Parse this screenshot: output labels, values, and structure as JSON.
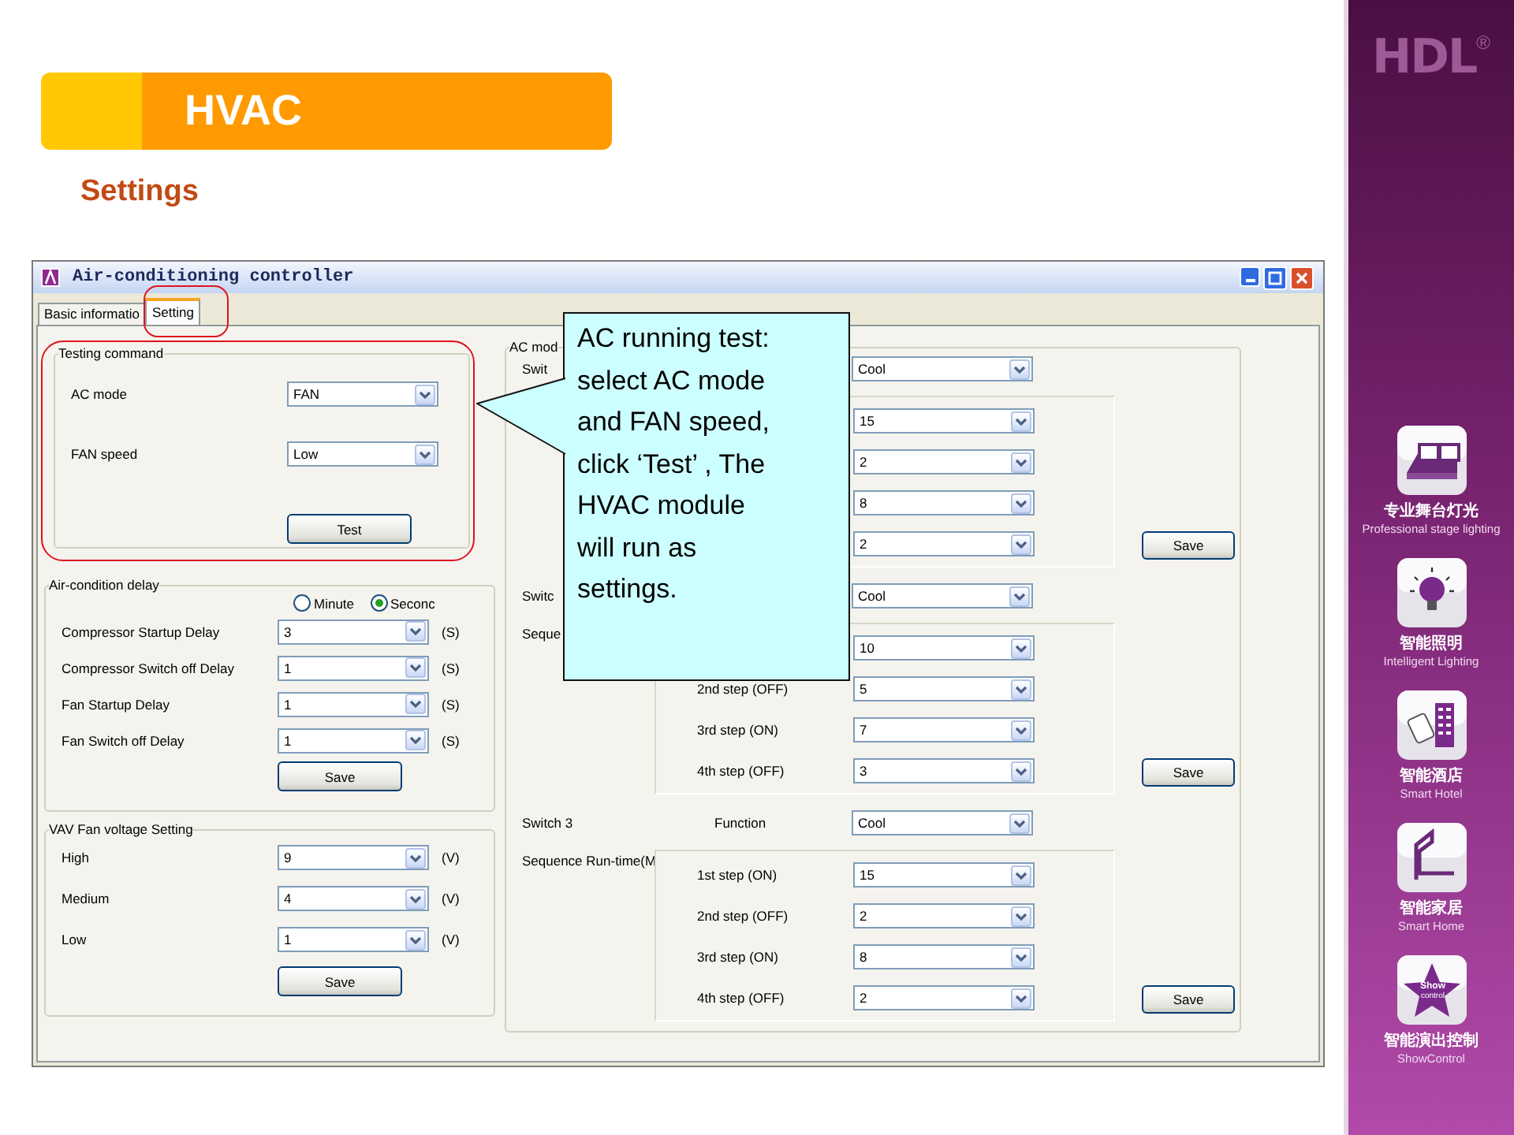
{
  "slide": {
    "title": "HVAC",
    "subtitle": "Settings"
  },
  "window": {
    "title": "Air-conditioning controller",
    "tabs": [
      {
        "label": "Basic informatio",
        "selected": false
      },
      {
        "label": "Setting",
        "selected": true
      }
    ],
    "left_groups": [
      {
        "title": "Testing command",
        "rows": [
          {
            "label": "AC mode",
            "value": "FAN"
          },
          {
            "label": "FAN speed",
            "value": "Low"
          }
        ],
        "button": "Test",
        "kind": "test"
      },
      {
        "title": "Air-condition delay",
        "radios": [
          {
            "label": "Minute",
            "selected": false
          },
          {
            "label": "Seconc",
            "selected": true
          }
        ],
        "rows": [
          {
            "label": "Compressor Startup Delay",
            "value": "3",
            "unit": "(S)"
          },
          {
            "label": "Compressor Switch off Delay",
            "value": "1",
            "unit": "(S)"
          },
          {
            "label": "Fan Startup Delay",
            "value": "1",
            "unit": "(S)"
          },
          {
            "label": "Fan Switch off Delay",
            "value": "1",
            "unit": "(S)"
          }
        ],
        "button": "Save",
        "kind": "delay"
      },
      {
        "title": "VAV Fan voltage Setting",
        "rows": [
          {
            "label": "High",
            "value": "9",
            "unit": "(V)"
          },
          {
            "label": "Medium",
            "value": "4",
            "unit": "(V)"
          },
          {
            "label": "Low",
            "value": "1",
            "unit": "(V)"
          }
        ],
        "button": "Save",
        "kind": "voltage"
      }
    ],
    "right_group": {
      "title": "AC mod",
      "switches": [
        {
          "label": "Swit",
          "function": "Cool",
          "steps": [
            {
              "value": "15"
            },
            {
              "value": "2"
            },
            {
              "value": "8"
            },
            {
              "value": "2"
            }
          ],
          "button": "Save"
        },
        {
          "label": "Switc",
          "sequence_label": "Seque",
          "function": "Cool",
          "steps": [
            {
              "value": "10"
            },
            {
              "label": "2nd step (OFF)",
              "value": "5"
            },
            {
              "label": "3rd step (ON)",
              "value": "7"
            },
            {
              "label": "4th step (OFF)",
              "value": "3"
            }
          ],
          "button": "Save"
        },
        {
          "label": "Switch 3",
          "function_label": "Function",
          "sequence_label": "Sequence Run-time(M",
          "function": "Cool",
          "steps": [
            {
              "label": "1st step (ON)",
              "value": "15"
            },
            {
              "label": "2nd step (OFF)",
              "value": "2"
            },
            {
              "label": "3rd step (ON)",
              "value": "8"
            },
            {
              "label": "4th step (OFF)",
              "value": "2"
            }
          ],
          "button": "Save"
        }
      ]
    }
  },
  "callout": {
    "text": "AC running test:\nselect AC mode\nand FAN speed,\nclick ‘Test’ , The\nHVAC module\nwill run as\nsettings."
  },
  "sidebar": {
    "logo": "HDL",
    "logo_mark": "®",
    "items": [
      {
        "kind": "stage",
        "zh": "专业舞台灯光",
        "en": "Professional stage lighting"
      },
      {
        "kind": "bulb",
        "zh": "智能照明",
        "en": "Intelligent Lighting"
      },
      {
        "kind": "hotel",
        "zh": "智能酒店",
        "en": "Smart Hotel"
      },
      {
        "kind": "home",
        "zh": "智能家居",
        "en": "Smart Home"
      },
      {
        "kind": "show",
        "zh": "智能演出控制",
        "en": "ShowControl",
        "badge": [
          "Show",
          "control"
        ]
      }
    ]
  }
}
